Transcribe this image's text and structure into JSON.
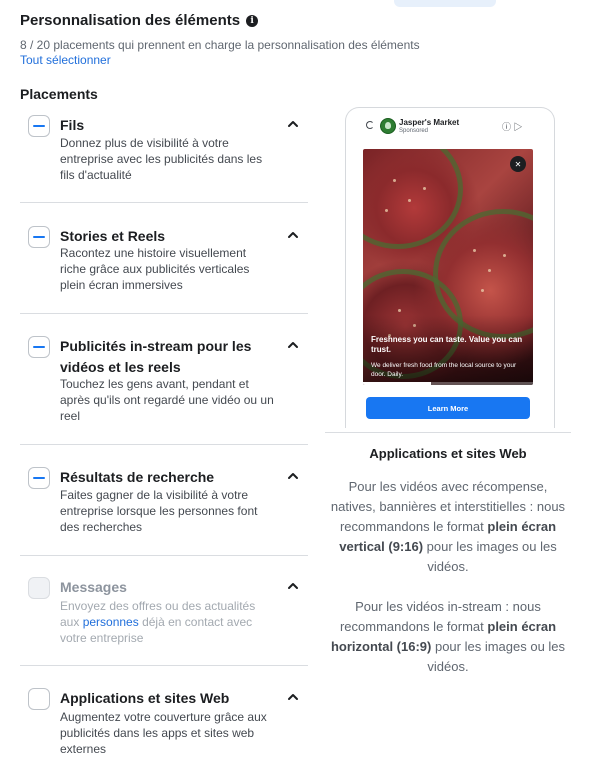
{
  "section": {
    "title": "Personnalisation des éléments",
    "info_icon": "i",
    "subtitle": "8 / 20 placements qui prennent en charge la personnalisation des éléments",
    "select_all": "Tout sélectionner"
  },
  "placements_heading": "Placements",
  "placements": [
    {
      "title": "Fils",
      "desc": "Donnez plus de visibilité à votre entreprise avec les publicités dans les fils d'actualité",
      "state": "indeterminate",
      "enabled": true
    },
    {
      "title": "Stories et Reels",
      "desc": "Racontez une histoire visuellement riche grâce aux publicités verticales plein écran immersives",
      "state": "indeterminate",
      "enabled": true
    },
    {
      "title": "Publicités in-stream pour les vidéos et les reels",
      "desc": "Touchez les gens avant, pendant et après qu'ils ont regardé une vidéo ou un reel",
      "state": "indeterminate",
      "enabled": true
    },
    {
      "title": "Résultats de recherche",
      "desc": "Faites gagner de la visibilité à votre entreprise lorsque les personnes font des recherches",
      "state": "indeterminate",
      "enabled": true
    },
    {
      "title": "Messages",
      "desc_before": "Envoyez des offres ou des actualités aux ",
      "desc_link": "personnes",
      "desc_after": " déjà en contact avec votre entreprise",
      "state": "unchecked",
      "enabled": false
    },
    {
      "title": "Applications et sites Web",
      "desc": "Augmentez votre couverture grâce aux publicités dans les apps et sites web externes",
      "state": "unchecked",
      "enabled": true
    }
  ],
  "preview": {
    "advertiser": "Jasper's Market",
    "sponsored": "Sponsored",
    "headline": "Freshness you can taste. Value you can trust.",
    "body": "We deliver fresh food from the local source to your door. Daily.",
    "cta": "Learn More",
    "video_progress": 0.4
  },
  "panel": {
    "title": "Applications et sites Web",
    "p1_before": "Pour les vidéos avec récompense, natives, bannières et interstitielles : nous recommandons le format ",
    "p1_bold": "plein écran vertical (9:16)",
    "p1_after": " pour les images ou les vidéos.",
    "p2_before": "Pour les vidéos in-stream : nous recommandons le format ",
    "p2_bold": "plein écran horizontal (16:9)",
    "p2_after": " pour les images ou les vidéos."
  },
  "colors": {
    "accent": "#1877f2",
    "link": "#216fdb",
    "divider": "#dadde1"
  },
  "icons": {
    "info": "info-icon",
    "chevron": "chevron-up-icon",
    "mute": "mute-icon",
    "spinner": "spinner-icon"
  }
}
